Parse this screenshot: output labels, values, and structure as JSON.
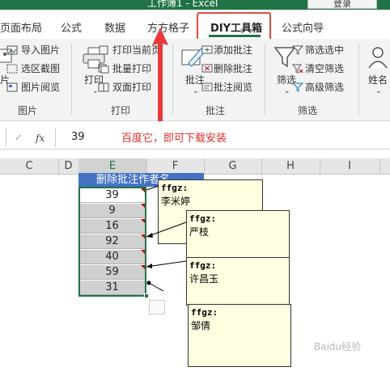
{
  "window": {
    "title": "工作簿1 - Excel",
    "login_button": "登录"
  },
  "tabs": [
    {
      "label": "页面布局"
    },
    {
      "label": "公式"
    },
    {
      "label": "数据"
    },
    {
      "label": "方方格子"
    },
    {
      "label": "DIY工具箱",
      "active": true
    },
    {
      "label": "公式向导"
    }
  ],
  "ribbon": {
    "picture_group": {
      "label": "图片",
      "insert_image": "导入图片",
      "region_screenshot": "选区截图",
      "image_browse": "图片阅览",
      "partial_big_label": "片"
    },
    "print_group": {
      "label": "打印",
      "print_button": "打印",
      "print_current_page": "打印当前页",
      "batch_print": "批量打印",
      "duplex_print": "双面打印"
    },
    "comment_group": {
      "label": "批注",
      "comment_button": "批注",
      "add_comment": "添加批注",
      "delete_comment": "删除批注",
      "browse_comment": "批注阅览"
    },
    "filter_group": {
      "label": "筛选",
      "filter_button": "筛选",
      "filter_selected": "筛选选中",
      "clear_filter": "清空筛选",
      "advanced_filter": "高级筛选"
    },
    "name_button": "姓名"
  },
  "formula_bar": {
    "cancel_symbol": "✓",
    "fx_label": "fx",
    "value": "39",
    "annotation": "百度它，即可下载安装"
  },
  "sheet": {
    "columns": [
      "C",
      "D",
      "E",
      "F",
      "G",
      "H",
      "I"
    ],
    "header_cell": "删除批注作者名",
    "e_values": [
      "39",
      "9",
      "16",
      "92",
      "40",
      "59",
      "31"
    ]
  },
  "comments": [
    {
      "author": "ffgz:",
      "text": "李米婷"
    },
    {
      "author": "ffgz:",
      "text": "严枝"
    },
    {
      "author": "ffgz:",
      "text": "许昌玉"
    },
    {
      "author": "ffgz:",
      "text": "邹倩"
    }
  ],
  "colors": {
    "excel_green": "#217346",
    "header_blue": "#4472c4",
    "comment_bg": "#ffffe1",
    "highlight_red": "#e04b3a"
  },
  "watermark": "Baidu经验"
}
